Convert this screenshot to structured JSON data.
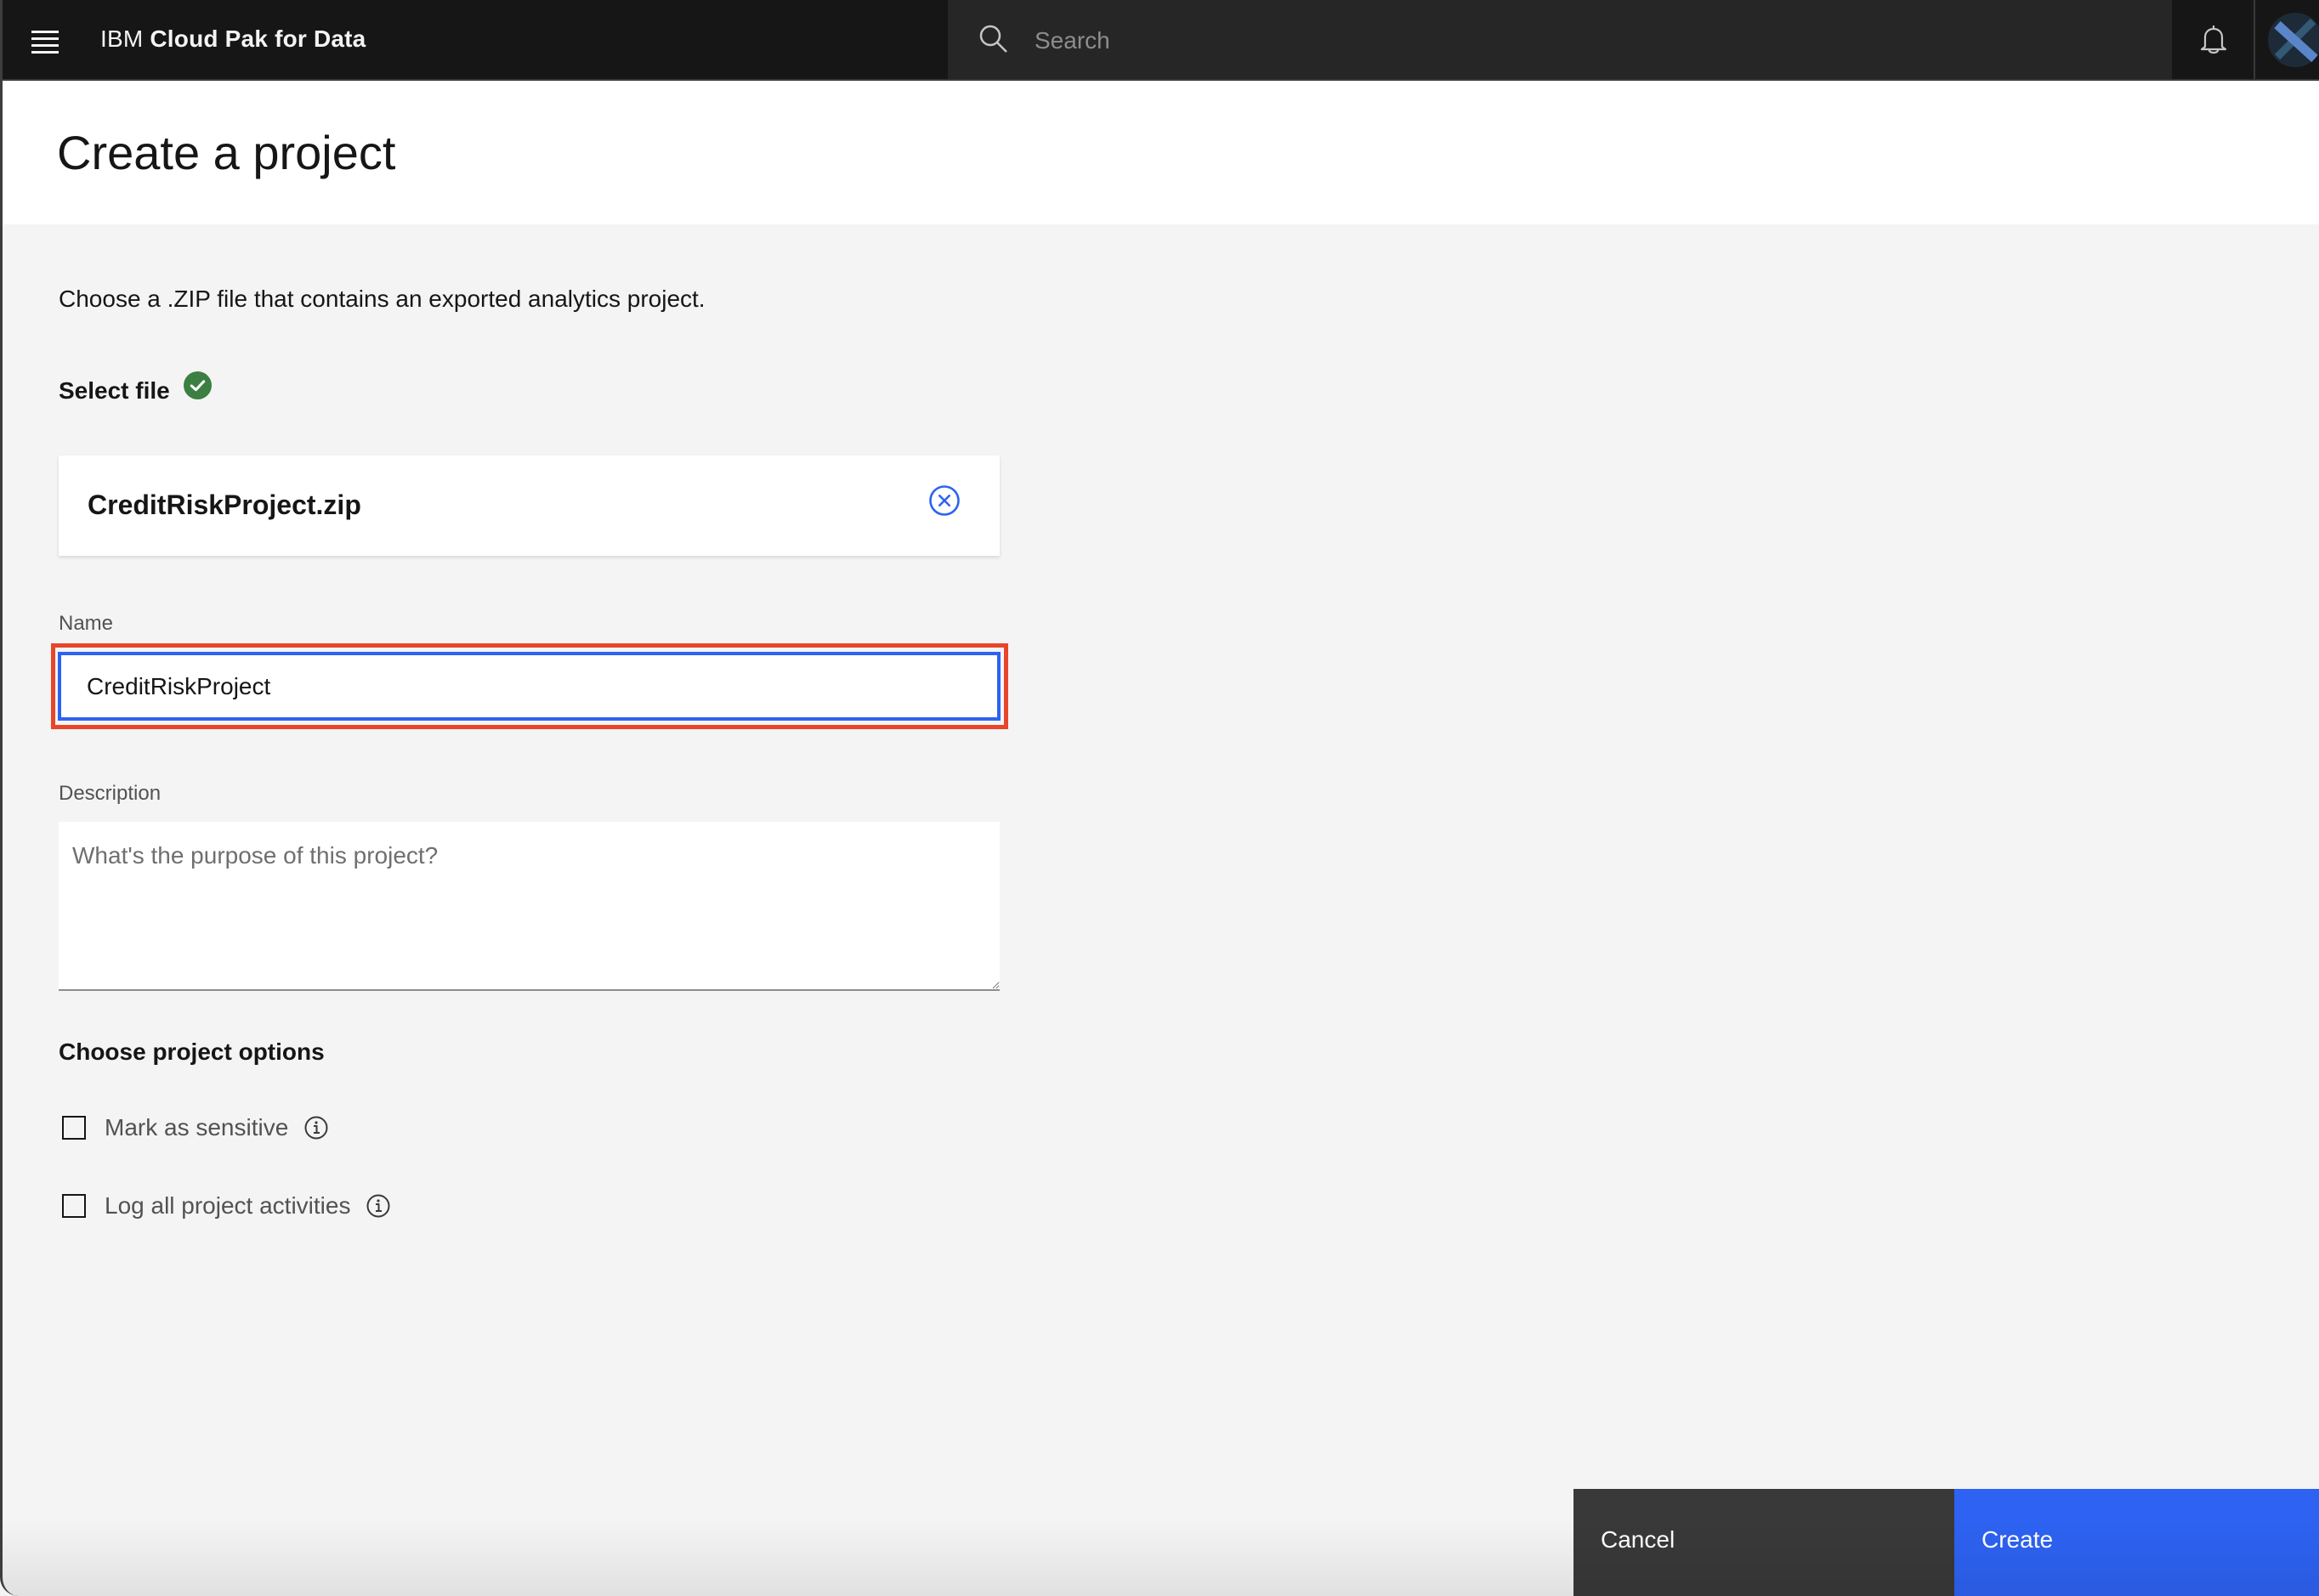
{
  "header": {
    "brand_prefix": "IBM",
    "brand_name": "Cloud Pak for Data",
    "search_placeholder": "Search",
    "icons": [
      "menu-icon",
      "search-icon",
      "notification-bell-icon",
      "user-avatar"
    ]
  },
  "page": {
    "title": "Create a project",
    "intro": "Choose a .ZIP file that contains an exported analytics project."
  },
  "select_file": {
    "label": "Select file",
    "status": "success",
    "status_icon": "checkmark-filled-icon",
    "file_name": "CreditRiskProject.zip",
    "remove_icon": "close-outline-icon"
  },
  "form": {
    "name_label": "Name",
    "name_value": "CreditRiskProject",
    "description_label": "Description",
    "description_value": "",
    "description_placeholder": "What's the purpose of this project?"
  },
  "options": {
    "title": "Choose project options",
    "items": [
      {
        "label": "Mark as sensitive",
        "checked": false,
        "info_icon": "information-icon"
      },
      {
        "label": "Log all project activities",
        "checked": false,
        "info_icon": "information-icon"
      }
    ]
  },
  "footer": {
    "cancel_label": "Cancel",
    "create_label": "Create"
  },
  "colors": {
    "header_bg": "#161616",
    "search_bg": "#262626",
    "primary_blue": "#2d62f2",
    "secondary_button": "#393939",
    "success_green": "#3b7f43",
    "highlight_red": "#e8452a",
    "page_bg": "#f4f4f4"
  }
}
